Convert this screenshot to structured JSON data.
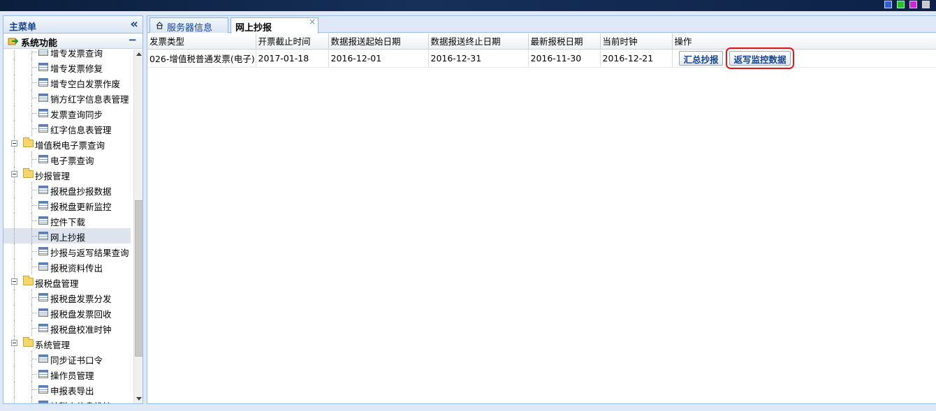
{
  "topbar": {
    "squares": [
      "#2f5fd0",
      "#22c322",
      "#c62ad6",
      "#c9c9c9"
    ]
  },
  "sidebar": {
    "title": "主菜单",
    "collapse_glyph": "«",
    "section": {
      "title": "系统功能",
      "minus": "−"
    },
    "items": [
      {
        "type": "leaf",
        "label": "增专发票查询"
      },
      {
        "type": "leaf",
        "label": "增专发票修复"
      },
      {
        "type": "leaf",
        "label": "增专空白发票作废"
      },
      {
        "type": "leaf",
        "label": "销方红字信息表管理"
      },
      {
        "type": "leaf",
        "label": "发票查询同步"
      },
      {
        "type": "leaf",
        "label": "红字信息表管理"
      },
      {
        "type": "folder",
        "label": "增值税电子票查询"
      },
      {
        "type": "leaf",
        "label": "电子票查询"
      },
      {
        "type": "folder",
        "label": "抄报管理"
      },
      {
        "type": "leaf",
        "label": "报税盘抄报数据"
      },
      {
        "type": "leaf",
        "label": "报税盘更新监控"
      },
      {
        "type": "leaf",
        "label": "控件下载"
      },
      {
        "type": "leaf",
        "label": "网上抄报",
        "selected": true
      },
      {
        "type": "leaf",
        "label": "抄报与返写结果查询"
      },
      {
        "type": "leaf",
        "label": "报税资料传出"
      },
      {
        "type": "folder",
        "label": "报税盘管理"
      },
      {
        "type": "leaf",
        "label": "报税盘发票分发"
      },
      {
        "type": "leaf",
        "label": "报税盘发票回收"
      },
      {
        "type": "leaf",
        "label": "报税盘校准时钟"
      },
      {
        "type": "folder",
        "label": "系统管理"
      },
      {
        "type": "leaf",
        "label": "同步证书口令"
      },
      {
        "type": "leaf",
        "label": "操作员管理"
      },
      {
        "type": "leaf",
        "label": "申报表导出"
      },
      {
        "type": "leaf",
        "label": "纳税人信息维护"
      }
    ]
  },
  "tabs": [
    {
      "label": "服务器信息",
      "active": false,
      "icon": "home-icon"
    },
    {
      "label": "网上抄报",
      "active": true,
      "close": "×"
    }
  ],
  "grid": {
    "columns": [
      "发票类型",
      "开票截止时间",
      "数据报送起始日期",
      "数据报送终止日期",
      "最新报税日期",
      "当前时钟",
      "操作"
    ],
    "rows": [
      {
        "cells": [
          "026-增值税普通发票(电子)",
          "2017-01-18",
          "2016-12-01",
          "2016-12-31",
          "2016-11-30",
          "2016-12-21"
        ],
        "actions": [
          "汇总抄报",
          "返写监控数据"
        ]
      }
    ]
  },
  "colors": {
    "accent": "#15428b",
    "border": "#99bbe8",
    "highlight": "#e01818"
  }
}
